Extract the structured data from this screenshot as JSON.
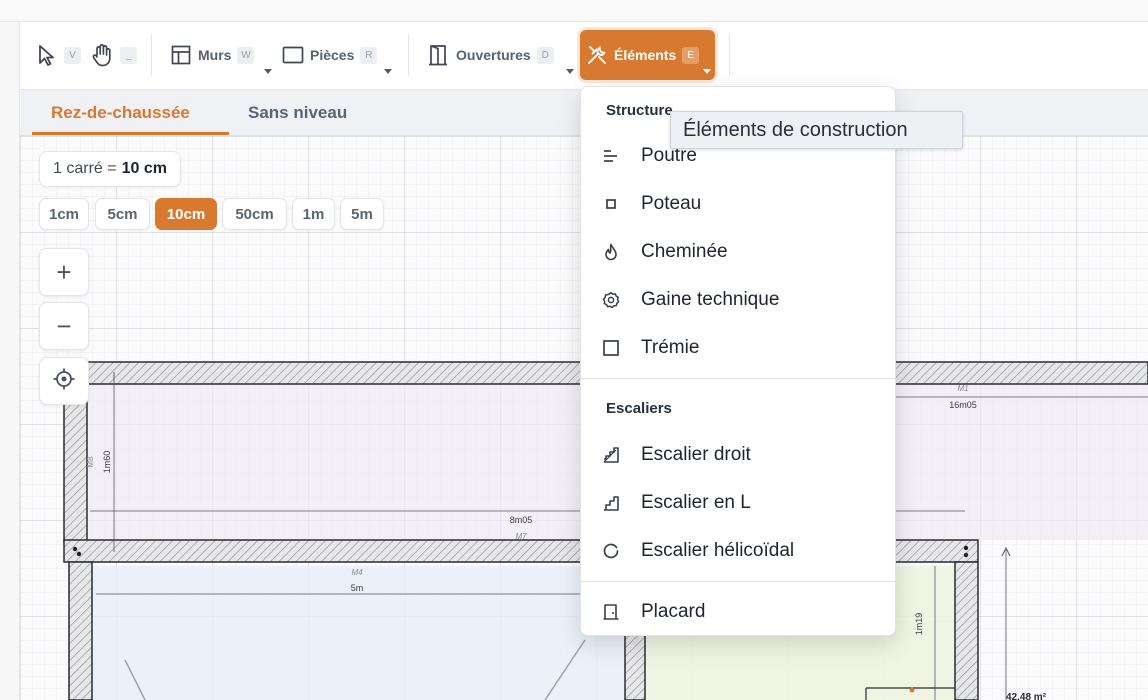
{
  "toolbar": {
    "select": {
      "label": "",
      "shortcut": "V"
    },
    "pan": {
      "label": "",
      "shortcut": "_"
    },
    "walls": {
      "label": "Murs",
      "shortcut": "W"
    },
    "rooms": {
      "label": "Pièces",
      "shortcut": "R"
    },
    "openings": {
      "label": "Ouvertures",
      "shortcut": "D"
    },
    "elements": {
      "label": "Éléments",
      "shortcut": "E"
    }
  },
  "levels": {
    "tabs": [
      {
        "label": "Rez-de-chaussée",
        "active": true
      },
      {
        "label": "Sans niveau",
        "active": false
      }
    ]
  },
  "grid": {
    "scale_prefix": "1 carré =",
    "scale_value": "10 cm",
    "options": [
      "1cm",
      "5cm",
      "10cm",
      "50cm",
      "1m",
      "5m"
    ],
    "selected": "10cm"
  },
  "canvas_controls": {
    "zoom_in": "+",
    "zoom_out": "−"
  },
  "plan": {
    "dim_16m05": "16m05",
    "wall_m1": "M1",
    "dim_1m60": "1m60",
    "wall_m8": "M8",
    "dim_8m05": "8m05",
    "wall_m7": "M7",
    "wall_m4": "M4",
    "dim_5m": "5m",
    "dim_1m19": "1m19",
    "area": "42.48 m²"
  },
  "elements_menu": {
    "sections": [
      {
        "heading": "Structure",
        "items": [
          {
            "label": "Poutre",
            "icon": "beam-icon"
          },
          {
            "label": "Poteau",
            "icon": "column-icon"
          },
          {
            "label": "Cheminée",
            "icon": "flame-icon"
          },
          {
            "label": "Gaine technique",
            "icon": "gear-icon"
          },
          {
            "label": "Trémie",
            "icon": "square-icon"
          }
        ]
      },
      {
        "heading": "Escaliers",
        "items": [
          {
            "label": "Escalier droit",
            "icon": "stairs-icon"
          },
          {
            "label": "Escalier en L",
            "icon": "stairs-l-icon"
          },
          {
            "label": "Escalier hélicoïdal",
            "icon": "spiral-icon"
          }
        ]
      },
      {
        "heading": "",
        "items": [
          {
            "label": "Placard",
            "icon": "cupboard-icon"
          }
        ]
      }
    ]
  },
  "tooltip": {
    "text": "Éléments de construction"
  },
  "colors": {
    "accent": "#d77a30",
    "text": "#1f2430",
    "muted": "#5c6473"
  }
}
